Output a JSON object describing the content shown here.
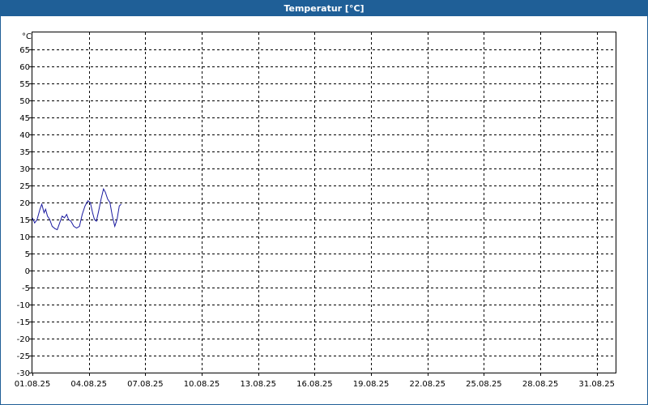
{
  "window": {
    "title": "Temperatur [°C]"
  },
  "chart_data": {
    "type": "line",
    "title": "Temperatur [°C]",
    "ylabel": "°C",
    "xlabel": "",
    "ylim": [
      -30,
      70
    ],
    "yticks": [
      -30,
      -25,
      -20,
      -15,
      -10,
      -5,
      0,
      5,
      10,
      15,
      20,
      25,
      30,
      35,
      40,
      45,
      50,
      55,
      60,
      65
    ],
    "xlim": [
      0,
      31
    ],
    "xticks": [
      {
        "v": 0,
        "label": "01.08.25"
      },
      {
        "v": 3,
        "label": "04.08.25"
      },
      {
        "v": 6,
        "label": "07.08.25"
      },
      {
        "v": 9,
        "label": "10.08.25"
      },
      {
        "v": 12,
        "label": "13.08.25"
      },
      {
        "v": 15,
        "label": "16.08.25"
      },
      {
        "v": 18,
        "label": "19.08.25"
      },
      {
        "v": 21,
        "label": "22.08.25"
      },
      {
        "v": 24,
        "label": "25.08.25"
      },
      {
        "v": 27,
        "label": "28.08.25"
      },
      {
        "v": 30,
        "label": "31.08.25"
      }
    ],
    "grid": true,
    "series": [
      {
        "color": "#1a1aa0",
        "points": [
          [
            0.0,
            15.5
          ],
          [
            0.12,
            14.0
          ],
          [
            0.25,
            15.0
          ],
          [
            0.4,
            18.0
          ],
          [
            0.5,
            19.5
          ],
          [
            0.62,
            17.0
          ],
          [
            0.7,
            18.0
          ],
          [
            0.8,
            16.0
          ],
          [
            0.92,
            15.0
          ],
          [
            1.05,
            13.0
          ],
          [
            1.2,
            12.3
          ],
          [
            1.32,
            12.0
          ],
          [
            1.45,
            14.0
          ],
          [
            1.58,
            16.0
          ],
          [
            1.7,
            15.5
          ],
          [
            1.82,
            16.5
          ],
          [
            1.92,
            15.0
          ],
          [
            2.05,
            14.5
          ],
          [
            2.2,
            13.0
          ],
          [
            2.35,
            12.5
          ],
          [
            2.5,
            13.0
          ],
          [
            2.65,
            16.5
          ],
          [
            2.8,
            19.0
          ],
          [
            2.95,
            20.5
          ],
          [
            3.08,
            20.0
          ],
          [
            3.2,
            17.0
          ],
          [
            3.3,
            15.0
          ],
          [
            3.4,
            14.5
          ],
          [
            3.52,
            17.5
          ],
          [
            3.65,
            21.0
          ],
          [
            3.78,
            24.0
          ],
          [
            3.88,
            23.0
          ],
          [
            4.0,
            21.0
          ],
          [
            4.12,
            20.0
          ],
          [
            4.25,
            16.0
          ],
          [
            4.38,
            13.0
          ],
          [
            4.5,
            15.0
          ],
          [
            4.62,
            19.0
          ],
          [
            4.72,
            19.5
          ]
        ]
      }
    ]
  }
}
